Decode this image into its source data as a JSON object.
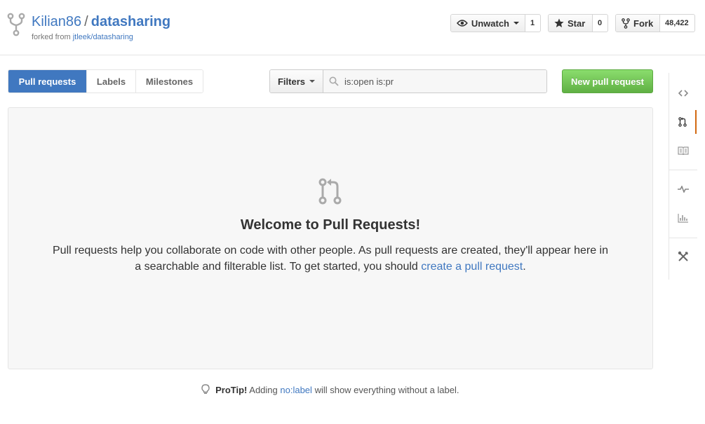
{
  "header": {
    "owner": "Kilian86",
    "separator": "/",
    "repo": "datasharing",
    "forked_from_prefix": "forked from",
    "forked_from": "jtleek/datasharing"
  },
  "actions": {
    "watch": {
      "label": "Unwatch",
      "count": "1"
    },
    "star": {
      "label": "Star",
      "count": "0"
    },
    "fork": {
      "label": "Fork",
      "count": "48,422"
    }
  },
  "subnav": {
    "tabs": [
      {
        "label": "Pull requests",
        "selected": true
      },
      {
        "label": "Labels",
        "selected": false
      },
      {
        "label": "Milestones",
        "selected": false
      }
    ],
    "filters_label": "Filters",
    "search_value": "is:open is:pr",
    "new_pr_label": "New pull request"
  },
  "blankslate": {
    "title": "Welcome to Pull Requests!",
    "desc_line1": "Pull requests help you collaborate on code with other people. As pull requests are created, they'll appear here in",
    "desc_line2": "a searchable and filterable list. To get started, you should",
    "link": "create a pull request",
    "period": "."
  },
  "protip": {
    "label": "ProTip!",
    "text_before": "Adding",
    "link": "no:label",
    "text_after": "will show everything without a label."
  },
  "sidebar": {
    "items": [
      {
        "icon": "code-icon",
        "selected": false
      },
      {
        "icon": "pull-request-icon",
        "selected": true
      },
      {
        "icon": "wiki-icon",
        "selected": false
      },
      {
        "icon": "pulse-icon",
        "selected": false
      },
      {
        "icon": "graph-icon",
        "selected": false
      },
      {
        "icon": "settings-icon",
        "selected": false
      }
    ]
  },
  "colors": {
    "link": "#4078c0",
    "selected_tab": "#4078c0",
    "new_pr_button": "#60b044",
    "sidebar_active": "#d26911"
  }
}
